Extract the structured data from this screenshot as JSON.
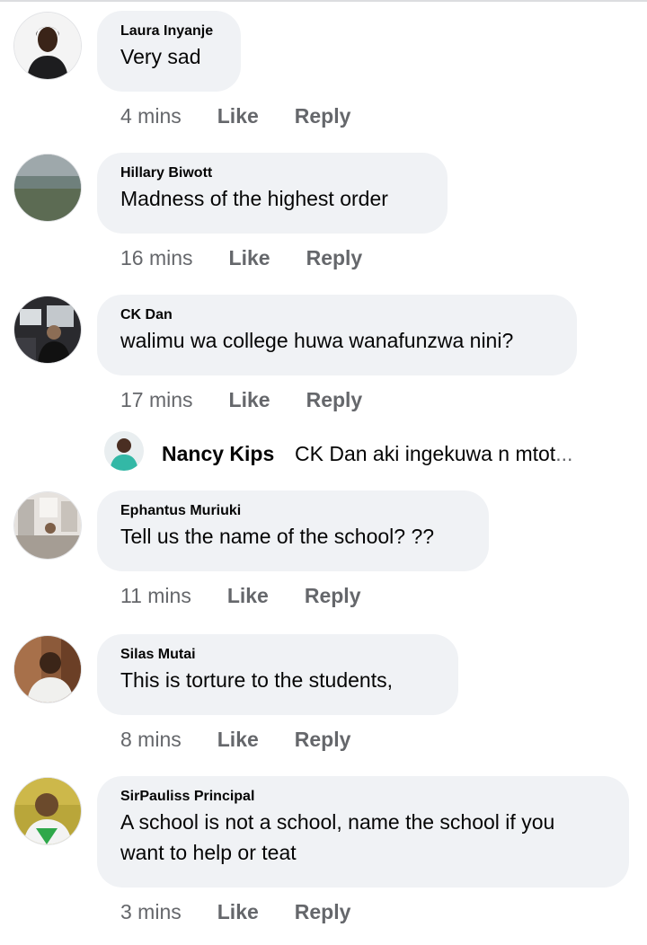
{
  "comments": [
    {
      "author": "Laura Inyanje",
      "text_lines": [
        "Very sad"
      ],
      "time": "4 mins",
      "like": "Like",
      "reply": "Reply"
    },
    {
      "author": "Hillary Biwott",
      "text_lines": [
        "Madness of the highest order"
      ],
      "time": "16 mins",
      "like": "Like",
      "reply": "Reply"
    },
    {
      "author": "CK Dan",
      "text_lines": [
        "walimu wa college huwa wanafunzwa nini?"
      ],
      "time": "17 mins",
      "like": "Like",
      "reply": "Reply"
    },
    {
      "author": "Ephantus Muriuki",
      "text_lines": [
        "Tell us the name of the school? ??"
      ],
      "time": "11 mins",
      "like": "Like",
      "reply": "Reply"
    },
    {
      "author": "Silas Mutai",
      "text_lines": [
        "This is torture to the students,"
      ],
      "time": "8 mins",
      "like": "Like",
      "reply": "Reply"
    },
    {
      "author": "SirPauliss Principal",
      "text_lines": [
        "A school is not a school, name the school if you",
        "want to help or teat"
      ],
      "time": "3 mins",
      "like": "Like",
      "reply": "Reply"
    }
  ],
  "reply_preview": {
    "author": "Nancy Kips",
    "text": "CK Dan aki ingekuwa n mtot",
    "ellipsis": "..."
  },
  "colors": {
    "bubble_bg": "#f0f2f5",
    "meta_text": "#65676b",
    "primary_text": "#050505"
  },
  "icons": {
    "avatars": [
      "avatar-laura-icon",
      "avatar-hillary-icon",
      "avatar-ckdan-icon",
      "avatar-ephantus-icon",
      "avatar-silas-icon",
      "avatar-sirpauliss-icon",
      "avatar-nancy-icon"
    ]
  }
}
